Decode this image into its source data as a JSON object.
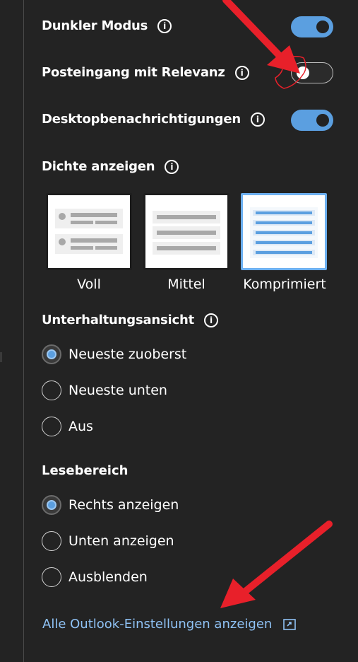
{
  "toggles": [
    {
      "label": "Dunkler Modus",
      "state": "on"
    },
    {
      "label": "Posteingang mit Relevanz",
      "state": "off"
    },
    {
      "label": "Desktopbenachrichtigungen",
      "state": "on"
    }
  ],
  "density": {
    "title": "Dichte anzeigen",
    "options": [
      {
        "label": "Voll",
        "selected": false
      },
      {
        "label": "Mittel",
        "selected": false
      },
      {
        "label": "Komprimiert",
        "selected": true
      }
    ]
  },
  "conversation": {
    "title": "Unterhaltungsansicht",
    "options": [
      {
        "label": "Neueste zuoberst",
        "checked": true
      },
      {
        "label": "Neueste unten",
        "checked": false
      },
      {
        "label": "Aus",
        "checked": false
      }
    ]
  },
  "reading_pane": {
    "title": "Lesebereich",
    "options": [
      {
        "label": "Rechts anzeigen",
        "checked": true
      },
      {
        "label": "Unten anzeigen",
        "checked": false
      },
      {
        "label": "Ausblenden",
        "checked": false
      }
    ]
  },
  "footer_link": "Alle Outlook-Einstellungen anzeigen",
  "colors": {
    "accent": "#5b9fe0",
    "link": "#8fc2f5",
    "background": "#232323",
    "annotation": "#e8202a"
  }
}
